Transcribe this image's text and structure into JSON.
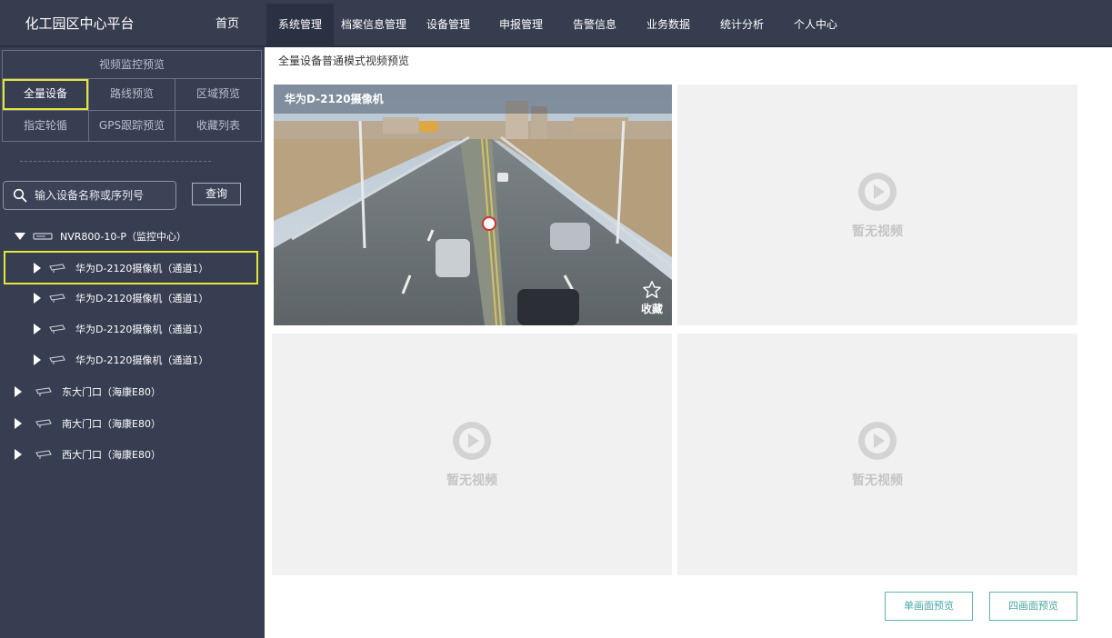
{
  "header": {
    "app_title": "化工园区中心平台",
    "nav": [
      "首页",
      "系统管理",
      "档案信息管理",
      "设备管理",
      "申报管理",
      "告警信息",
      "业务数据",
      "统计分析",
      "个人中心"
    ],
    "active_nav": "系统管理"
  },
  "sidebar": {
    "tab_header": "视频监控预览",
    "tabs_row1": [
      "全量设备",
      "路线预览",
      "区域预览"
    ],
    "tabs_row2": [
      "指定轮循",
      "GPS跟踪预览",
      "收藏列表"
    ],
    "active_tab": "全量设备",
    "search": {
      "placeholder": "输入设备名称或序列号",
      "button": "查询"
    },
    "tree": {
      "root": "NVR800-10-P（监控中心）",
      "children": [
        "华为D-2120摄像机（通道1）",
        "华为D-2120摄像机（通道1）",
        "华为D-2120摄像机（通道1）",
        "华为D-2120摄像机（通道1）"
      ],
      "selected_child_index": 0,
      "others": [
        "东大门口（海康E80）",
        "南大门口（海康E80）",
        "西大门口（海康E80）"
      ]
    }
  },
  "main": {
    "breadcrumb": "全量设备普通模式视频预览",
    "live_camera_name": "华为D-2120摄像机",
    "favorite_label": "收藏",
    "empty_text": "暂无视频",
    "buttons": {
      "single": "单画面预览",
      "quad": "四画面预览"
    }
  },
  "colors": {
    "header_bg": "#363d4f",
    "sidebar_bg": "#373e51",
    "highlight": "#e6e633",
    "accent": "#4aa8a6"
  }
}
